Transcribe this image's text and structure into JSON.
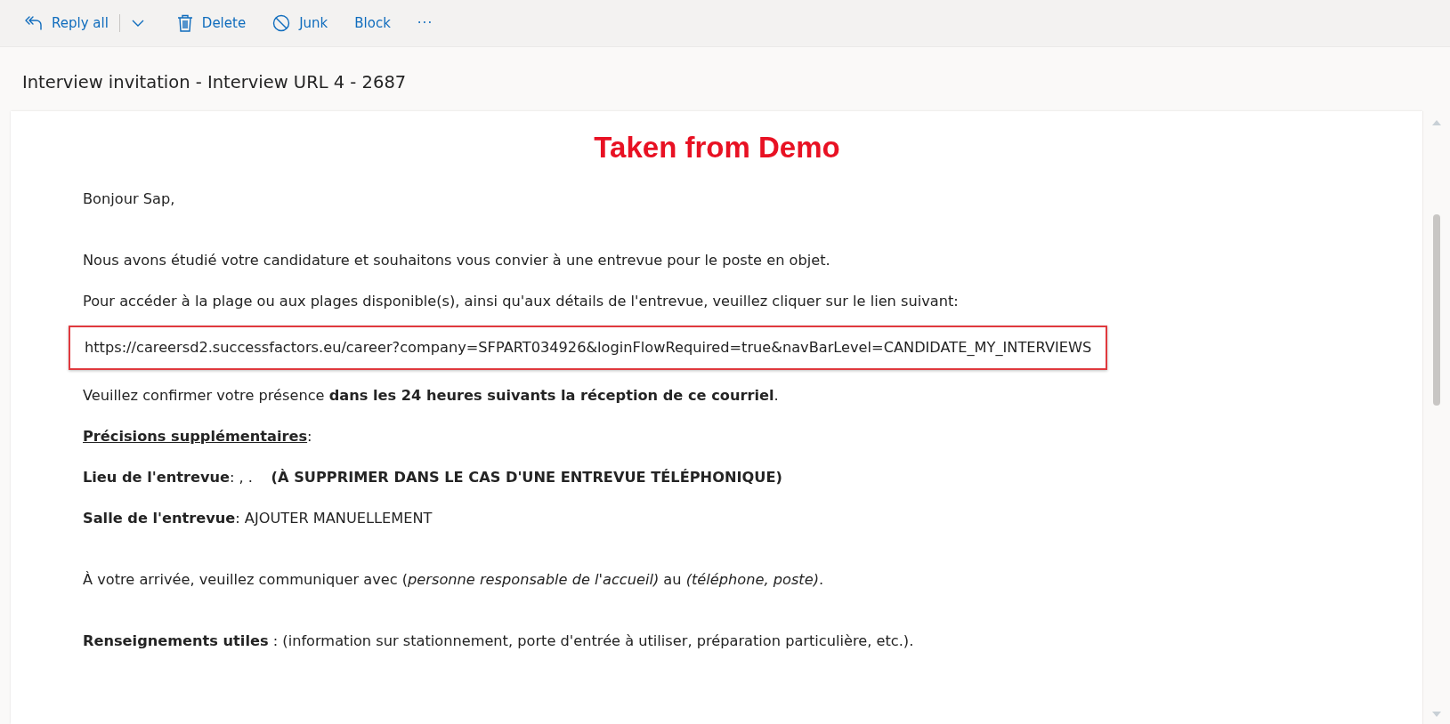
{
  "toolbar": [
    {
      "kind": "reply",
      "label": "Reply all"
    },
    {
      "kind": "caret"
    },
    {
      "kind": "delete",
      "label": "Delete"
    },
    {
      "kind": "junk",
      "label": "Junk"
    },
    {
      "kind": "plain",
      "label": "Block"
    },
    {
      "kind": "more",
      "label": "···"
    }
  ],
  "subject": "Interview invitation - Interview URL 4 - 2687",
  "annotation": "Taken from Demo",
  "blocks": [
    [
      {
        "kind": "text",
        "text": "Bonjour Sap,"
      }
    ],
    [
      {
        "kind": "text",
        "text": "Nous avons étudié votre candidature et souhaitons vous convier à une entrevue pour le poste en objet."
      },
      {
        "kind": "text",
        "text": "Pour accéder à la plage ou aux plages disponible(s), ainsi qu'aux détails de l'entrevue, veuillez cliquer sur le lien suivant:"
      },
      {
        "kind": "link",
        "text": "https://careersd2.successfactors.eu/career?company=SFPART034926&loginFlowRequired=true&navBarLevel=CANDIDATE_MY_INTERVIEWS",
        "highlighted": true
      },
      {
        "kind": "text",
        "text": "Veuillez confirmer votre présence **dans les 24 heures suivants la réception de ce courriel**."
      },
      {
        "kind": "underlined",
        "text": "Précisions supplémentaires",
        "suffix": ":"
      },
      {
        "kind": "text",
        "text": "**Lieu de l'entrevue**: , .    **(À SUPPRIMER DANS LE CAS D'UNE ENTREVUE TÉLÉPHONIQUE)**"
      },
      {
        "kind": "text",
        "text": "**Salle de l'entrevue**: AJOUTER MANUELLEMENT"
      }
    ],
    [
      {
        "kind": "text",
        "text": "À votre arrivée, veuillez communiquer avec (*personne responsable de l'accueil)* au *(téléphone, poste)*."
      }
    ],
    [
      {
        "kind": "text",
        "text": "**Renseignements utiles** : (information sur stationnement, porte d'entrée à utiliser, préparation particulière, etc.)."
      }
    ]
  ]
}
